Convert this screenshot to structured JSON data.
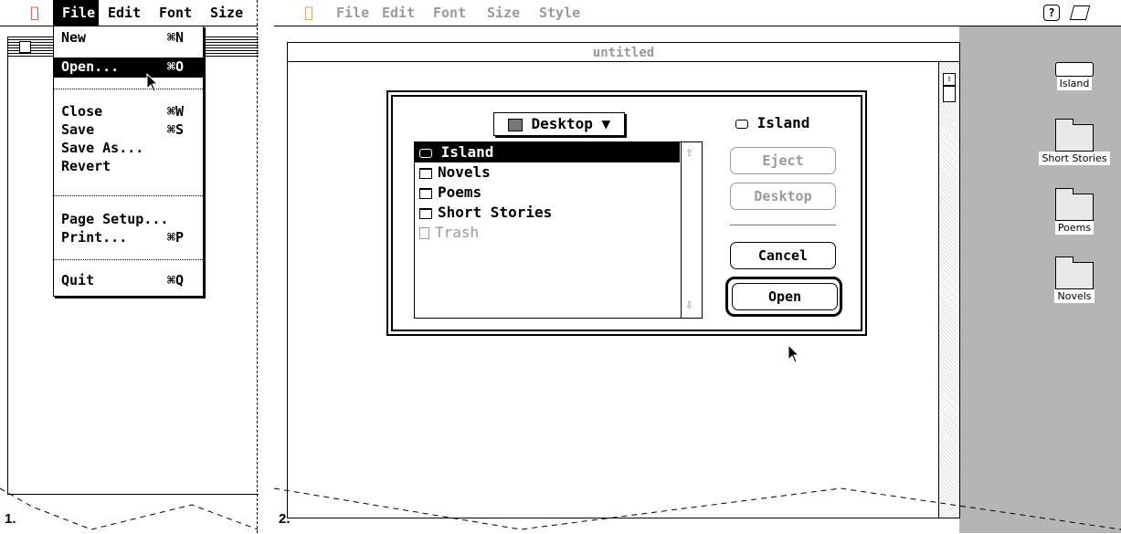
{
  "panel1": {
    "menubar": {
      "apple_icon": "apple-icon",
      "items": [
        "File",
        "Edit",
        "Font",
        "Size"
      ]
    },
    "file_menu": {
      "groups": [
        [
          {
            "label": "New",
            "shortcut": "⌘N"
          },
          {
            "label": "Open...",
            "shortcut": "⌘O",
            "highlighted": true
          }
        ],
        [
          {
            "label": "Close",
            "shortcut": "⌘W"
          },
          {
            "label": "Save",
            "shortcut": "⌘S"
          },
          {
            "label": "Save As...",
            "shortcut": ""
          },
          {
            "label": "Revert",
            "shortcut": ""
          }
        ],
        [
          {
            "label": "Page Setup...",
            "shortcut": ""
          },
          {
            "label": "Print...",
            "shortcut": "⌘P"
          }
        ],
        [
          {
            "label": "Quit",
            "shortcut": "⌘Q"
          }
        ]
      ]
    },
    "caption": "1."
  },
  "panel2": {
    "menubar": {
      "apple_icon": "apple-icon",
      "items": [
        "File",
        "Edit",
        "Font",
        "Size",
        "Style"
      ],
      "right_icons": [
        "help-icon",
        "finder-icon"
      ]
    },
    "window_title": "untitled",
    "dialog": {
      "location_popup": "Desktop",
      "volume_name": "Island",
      "files": [
        {
          "name": "Island",
          "icon": "disk-icon",
          "selected": true,
          "disabled": false
        },
        {
          "name": "Novels",
          "icon": "folder-icon",
          "selected": false,
          "disabled": false
        },
        {
          "name": "Poems",
          "icon": "folder-icon",
          "selected": false,
          "disabled": false
        },
        {
          "name": "Short Stories",
          "icon": "folder-icon",
          "selected": false,
          "disabled": false
        },
        {
          "name": "Trash",
          "icon": "trash-icon",
          "selected": false,
          "disabled": true
        }
      ],
      "buttons": {
        "eject": "Eject",
        "desktop": "Desktop",
        "cancel": "Cancel",
        "open": "Open"
      }
    },
    "desktop_icons": [
      {
        "label": "Island",
        "icon": "disk-icon"
      },
      {
        "label": "Short Stories",
        "icon": "folder-icon"
      },
      {
        "label": "Poems",
        "icon": "folder-icon"
      },
      {
        "label": "Novels",
        "icon": "folder-icon"
      }
    ],
    "caption": "2."
  }
}
